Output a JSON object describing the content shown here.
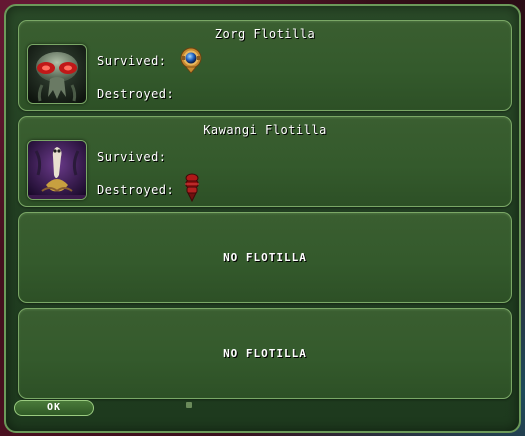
{
  "flotillas": [
    {
      "name": "Zorg Flotilla",
      "portrait": "zorg-alien-portrait",
      "survived_label": "Survived:",
      "destroyed_label": "Destroyed:",
      "survived_ships": [
        "blue-orb-ship-icon"
      ],
      "destroyed_ships": []
    },
    {
      "name": "Kawangi Flotilla",
      "portrait": "kawangi-alien-portrait",
      "survived_label": "Survived:",
      "destroyed_label": "Destroyed:",
      "survived_ships": [],
      "destroyed_ships": [
        "red-segmented-ship-icon"
      ]
    },
    {
      "empty_text": "NO FLOTILLA"
    },
    {
      "empty_text": "NO FLOTILLA"
    }
  ],
  "ok_label": "OK",
  "colors": {
    "panel_bg": "#345a2c",
    "panel_border": "#7aa766",
    "dialog_bg": "#223f22",
    "text": "#ffffff"
  }
}
